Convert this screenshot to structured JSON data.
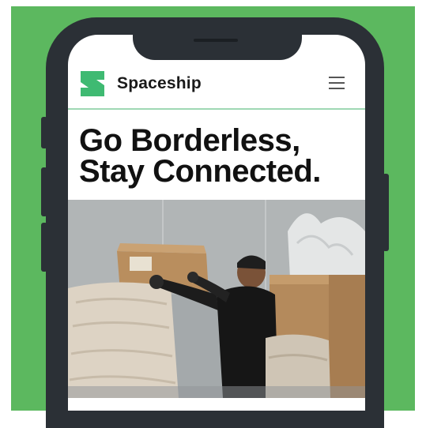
{
  "header": {
    "brand": "Spaceship",
    "logo_icon": "spaceship-logo-icon",
    "menu_icon": "hamburger-menu-icon"
  },
  "hero": {
    "title_line1": "Go Borderless,",
    "title_line2": "Stay Connected."
  },
  "colors": {
    "background": "#5cb85f",
    "phone_frame": "#2b3036",
    "accent": "#3fba72",
    "header_rule": "#9fd8b4"
  }
}
